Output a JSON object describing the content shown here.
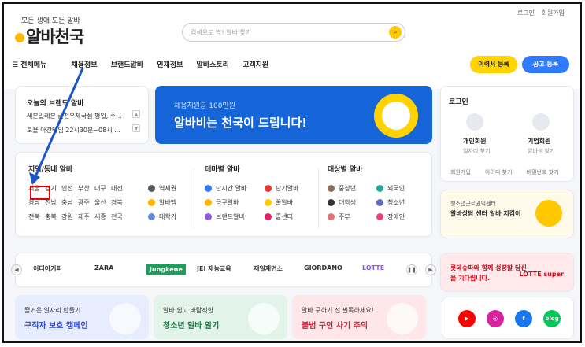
{
  "header": {
    "login": "로그인",
    "signup": "회원가입",
    "slogan": "모든 생애 모든 알바",
    "logo": "알바천국",
    "search_placeholder": "검색으로 딱! 알바 찾기"
  },
  "nav": {
    "menu": "전체메뉴",
    "items": [
      "채용정보",
      "브랜드알바",
      "인재정보",
      "알바스토리",
      "고객지원"
    ],
    "resume_btn": "이력서 등록",
    "ad_btn": "공고 등록"
  },
  "brand_box": {
    "title": "오늘의 브랜드 알바",
    "line1": "세븐일레븐 금천우체국점 평일, 주...",
    "line2": "토욜 아간타임 22시30분~08시 ..."
  },
  "hero": {
    "sub": "채용지원금 100만원",
    "main": "알바비는 천국이 드립니다!"
  },
  "login_box": {
    "title": "로그인",
    "personal": "개인회원",
    "personal_sub": "일자리 찾기",
    "corp": "기업회원",
    "corp_sub": "알바생 찾기",
    "links": [
      "회원가입",
      "아이디 찾기",
      "비밀번호 찾기"
    ]
  },
  "region": {
    "title": "지역/동네 알바",
    "rows": [
      [
        "서울",
        "경기",
        "인천",
        "부산",
        "대구",
        "대전"
      ],
      [
        "경남",
        "전남",
        "충남",
        "광주",
        "울산",
        "경북"
      ],
      [
        "전북",
        "충북",
        "강원",
        "제주",
        "세종",
        "전국"
      ]
    ],
    "selected": "서울",
    "col2": [
      "역세권",
      "알바맵",
      "대학가"
    ]
  },
  "theme": {
    "title": "테마별 알바",
    "items": [
      "단시간 알바",
      "단기알바",
      "급구알바",
      "꿀알바",
      "브랜드알바",
      "콜센터"
    ]
  },
  "target": {
    "title": "대상별 알바",
    "items": [
      "중장년",
      "외국인",
      "대학생",
      "청소년",
      "주부",
      "장애인"
    ]
  },
  "promo": {
    "small": "청소년근로권익센터",
    "big": "알바상담 센터 알바 지킴이"
  },
  "logos": [
    "이디야커피",
    "ZARA",
    "Jungkene",
    "JEI 재능교육",
    "제일제면소",
    "GIORDANO",
    "LOTTE"
  ],
  "lotte": {
    "text": "롯데슈파와 함께 성장할 당신을 기다립니다.",
    "logo": "LOTTE super"
  },
  "banners": [
    {
      "small": "즐거운 일자리 만들기",
      "big": "구직자 보호 캠페인",
      "bg": "#e7ecff",
      "color": "#2b48d8"
    },
    {
      "small": "알바 쉽고 바람직한",
      "big": "청소년 알바 알기",
      "bg": "#e2f4ea",
      "color": "#1f7a4a"
    },
    {
      "small": "알바 구하기 전 필독하세요!",
      "big": "불법 구인 사기 주의",
      "bg": "#ffe6e8",
      "color": "#d21f36"
    }
  ],
  "social": [
    "YouTube",
    "Instagram",
    "facebook",
    "blog"
  ]
}
